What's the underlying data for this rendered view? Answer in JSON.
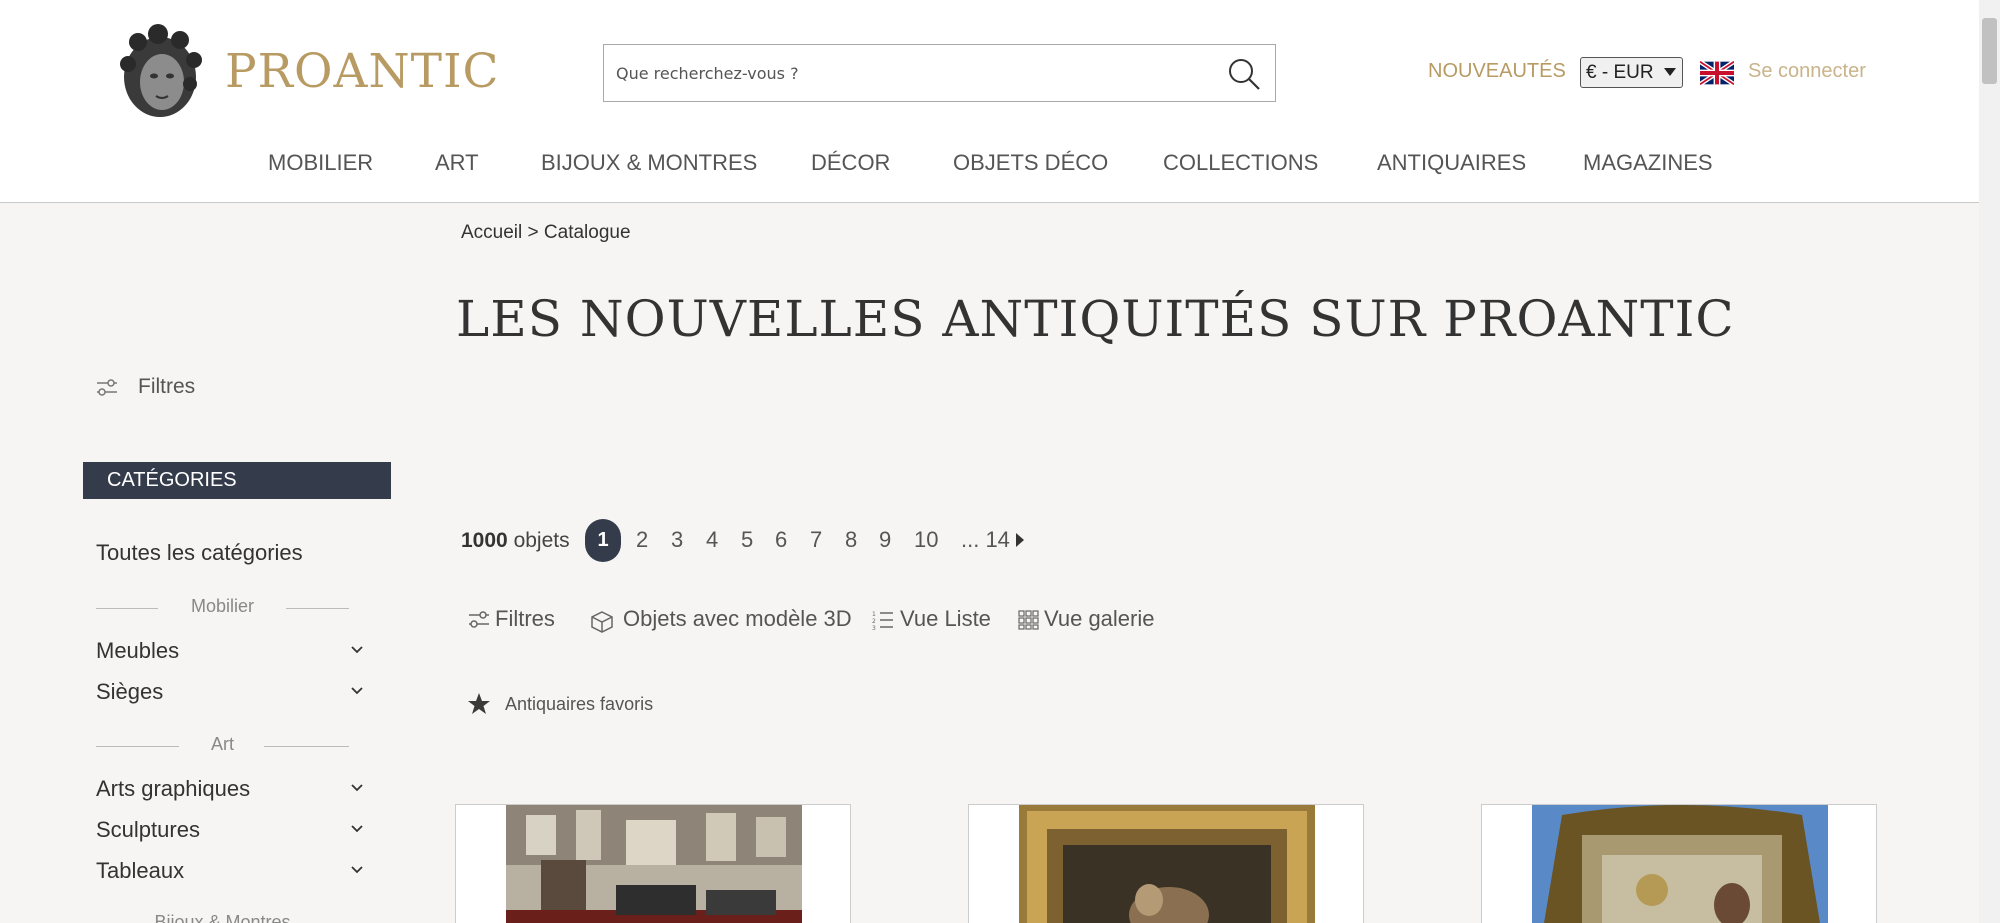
{
  "header": {
    "logo_text": "PROANTIC",
    "search_placeholder": "Que recherchez-vous ?",
    "nouveautes": "NOUVEAUTÉS",
    "currency": "€ - EUR",
    "login": "Se connecter",
    "accent_color": "#b89a63"
  },
  "nav": [
    "MOBILIER",
    "ART",
    "BIJOUX & MONTRES",
    "DÉCOR",
    "OBJETS DÉCO",
    "COLLECTIONS",
    "ANTIQUAIRES",
    "MAGAZINES"
  ],
  "sidebar": {
    "filtres": "Filtres",
    "categories_title": "CATÉGORIES",
    "all_categories": "Toutes les catégories",
    "group_mobilier": "Mobilier",
    "meubles": "Meubles",
    "sieges": "Sièges",
    "group_art": "Art",
    "arts_graphiques": "Arts graphiques",
    "sculptures": "Sculptures",
    "tableaux": "Tableaux",
    "group_bijoux": "Bijoux & Montres"
  },
  "main": {
    "breadcrumb": "Accueil > Catalogue",
    "title": "LES NOUVELLES ANTIQUITÉS SUR PROANTIC",
    "count_number": "1000",
    "count_label": "objets",
    "pages": [
      "1",
      "2",
      "3",
      "4",
      "5",
      "6",
      "7",
      "8",
      "9",
      "10",
      "... 14"
    ],
    "active_page": "1",
    "tools": {
      "filtres": "Filtres",
      "objets_3d": "Objets avec modèle 3D",
      "vue_liste": "Vue Liste",
      "vue_galerie": "Vue galerie"
    },
    "antiquaires_favoris": "Antiquaires favoris"
  }
}
